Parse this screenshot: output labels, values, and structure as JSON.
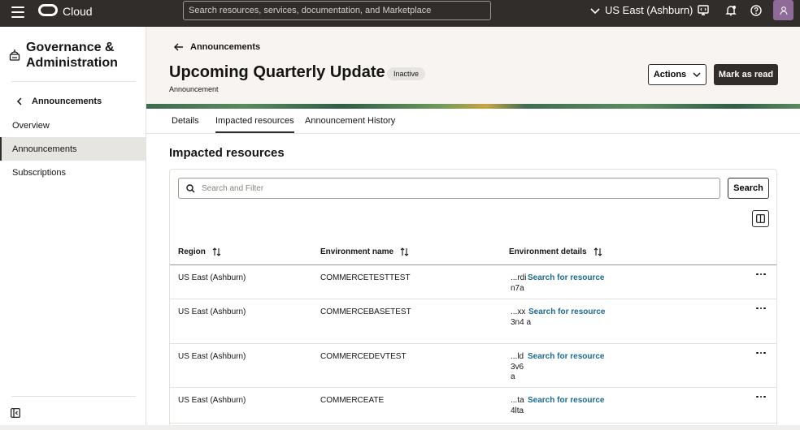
{
  "topbar": {
    "brand": "Cloud",
    "search_placeholder": "Search resources, services, documentation, and Marketplace",
    "region": "US East (Ashburn)",
    "icons": [
      "hamburger-icon",
      "cloud-logo-icon",
      "chevron-down-icon",
      "code-editor-icon",
      "bell-icon",
      "help-icon",
      "user-icon"
    ]
  },
  "sidebar": {
    "title": "Governance & Administration",
    "back_label": "Announcements",
    "items": [
      {
        "label": "Overview",
        "active": false
      },
      {
        "label": "Announcements",
        "active": true
      },
      {
        "label": "Subscriptions",
        "active": false
      }
    ]
  },
  "header": {
    "breadcrumb": "Announcements",
    "title": "Upcoming Quarterly Update",
    "status": "Inactive",
    "subtitle": "Announcement",
    "actions_label": "Actions",
    "mark_read_label": "Mark as read"
  },
  "tabs": [
    {
      "label": "Details",
      "active": false
    },
    {
      "label": "Impacted resources",
      "active": true
    },
    {
      "label": "Announcement History",
      "active": false
    }
  ],
  "content": {
    "section_title": "Impacted resources",
    "filter_placeholder": "Search and Filter",
    "search_label": "Search",
    "columns": [
      "Region",
      "Environment name",
      "Environment details"
    ],
    "rows": [
      {
        "region": "US East (Ashburn)",
        "env_name": "COMMERCETESTTEST",
        "detail_prefix": "...rdi",
        "detail_rest": "n7a",
        "link": "Search for resource"
      },
      {
        "region": "US East (Ashburn)",
        "env_name": "COMMERCEBASETEST",
        "detail_prefix": "...xx",
        "detail_rest": "3n4 a",
        "link": "Search for resource"
      },
      {
        "region": "US East (Ashburn)",
        "env_name": "COMMERCEDEVTEST",
        "detail_prefix": "...ld",
        "detail_rest": "3v6 a",
        "link": "Search for resource"
      },
      {
        "region": "US East (Ashburn)",
        "env_name": "COMMERCEATE",
        "detail_prefix": "...ta",
        "detail_rest": "4lta",
        "link": "Search for resource"
      }
    ]
  },
  "colors": {
    "topbar": "#312d2a",
    "link": "#1b6a8e",
    "header_bg": "#f7f4f1",
    "avatar": "#8f6b9a"
  }
}
